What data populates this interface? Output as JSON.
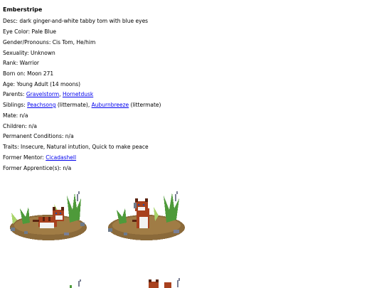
{
  "title": "Emberstripe",
  "desc": {
    "label": "Desc:",
    "value": "dark ginger-and-white tabby tom with blue eyes"
  },
  "eye_color": {
    "label": "Eye Color:",
    "value": "Pale Blue"
  },
  "gender": {
    "label": "Gender/Pronouns:",
    "value": "Cis Tom, He/him"
  },
  "sexuality": {
    "label": "Sexuality:",
    "value": "Unknown"
  },
  "rank": {
    "label": "Rank:",
    "value": "Warrior"
  },
  "born": {
    "label": "Born on:",
    "value": "Moon 271"
  },
  "age": {
    "label": "Age:",
    "value": "Young Adult (14 moons)"
  },
  "parents": {
    "label": "Parents:",
    "links": [
      "Gravelstorm",
      "Hornetdusk"
    ],
    "sep": ", "
  },
  "siblings": {
    "label": "Siblings:",
    "links": [
      "Peachsong",
      "Auburnbreeze"
    ],
    "note": "(littermate)"
  },
  "mate": {
    "label": "Mate:",
    "value": "n/a"
  },
  "children": {
    "label": "Children:",
    "value": "n/a"
  },
  "conditions": {
    "label": "Permanent Conditions:",
    "value": "n/a"
  },
  "traits": {
    "label": "Traits:",
    "value": "Insecure, Natural intution, Quick to make peace"
  },
  "mentor": {
    "label": "Former Mentor:",
    "link": "Cicadashell"
  },
  "apprentices": {
    "label": "Former Apprentice(s):",
    "value": "n/a"
  },
  "colors": {
    "link": "#0000ee",
    "ginger": "#a8411e",
    "ginger_dark": "#5a2310",
    "dirt": "#8b6a3a",
    "grass": "#4e9a3a",
    "grass_light": "#a9d46a"
  }
}
